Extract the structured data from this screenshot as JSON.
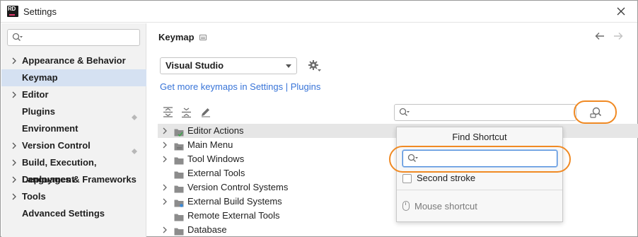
{
  "window": {
    "title": "Settings",
    "app_logo_text": "RD"
  },
  "sidebar": {
    "search_placeholder": "",
    "items": [
      {
        "label": "Appearance & Behavior",
        "expandable": true,
        "selected": false
      },
      {
        "label": "Keymap",
        "expandable": false,
        "selected": true
      },
      {
        "label": "Editor",
        "expandable": true,
        "selected": false
      },
      {
        "label": "Plugins",
        "expandable": false,
        "selected": false
      },
      {
        "label": "Environment",
        "expandable": false,
        "selected": false
      },
      {
        "label": "Version Control",
        "expandable": true,
        "selected": false
      },
      {
        "label": "Build, Execution, Deployment",
        "expandable": true,
        "selected": false
      },
      {
        "label": "Languages & Frameworks",
        "expandable": true,
        "selected": false
      },
      {
        "label": "Tools",
        "expandable": true,
        "selected": false
      },
      {
        "label": "Advanced Settings",
        "expandable": false,
        "selected": false
      }
    ]
  },
  "main": {
    "title": "Keymap",
    "keymap_select": {
      "value": "Visual Studio"
    },
    "link": "Get more keymaps in Settings | Plugins",
    "tree_search_placeholder": "",
    "tree": [
      {
        "label": "Editor Actions",
        "expandable": true,
        "icon": "editor-actions-icon",
        "selected": true
      },
      {
        "label": "Main Menu",
        "expandable": true,
        "icon": "menu-folder-icon",
        "selected": false
      },
      {
        "label": "Tool Windows",
        "expandable": true,
        "icon": "folder-icon",
        "selected": false
      },
      {
        "label": "External Tools",
        "expandable": false,
        "icon": "folder-icon",
        "selected": false
      },
      {
        "label": "Version Control Systems",
        "expandable": true,
        "icon": "folder-icon",
        "selected": false
      },
      {
        "label": "External Build Systems",
        "expandable": true,
        "icon": "build-folder-icon",
        "selected": false
      },
      {
        "label": "Remote External Tools",
        "expandable": false,
        "icon": "folder-icon",
        "selected": false
      },
      {
        "label": "Database",
        "expandable": true,
        "icon": "folder-icon",
        "selected": false
      }
    ]
  },
  "popup": {
    "title": "Find Shortcut",
    "input_value": "",
    "second_stroke_label": "Second stroke",
    "second_stroke_checked": false,
    "mouse_label": "Mouse shortcut"
  },
  "colors": {
    "accent_link": "#3874d8",
    "selection": "#d5e1f2",
    "highlight_ring": "#f08a24"
  }
}
